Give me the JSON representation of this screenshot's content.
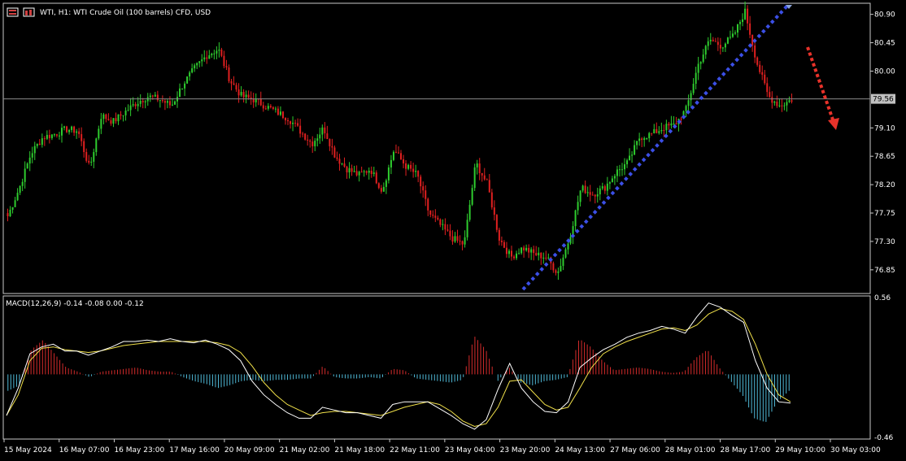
{
  "header": {
    "symbol_title": "WTI, H1:  WTI Crude Oil (100 barrels) CFD, USD"
  },
  "colors": {
    "background": "#000000",
    "bull_candle": "#2ecc2e",
    "bear_candle": "#e02020",
    "trendline": "#3b4fe6",
    "arrow": "#e8322a",
    "macd_line": "#ffffff",
    "signal_line": "#f0e04a",
    "hist_positive": "#d42b2b",
    "hist_negative": "#4fb8d6",
    "grid_border": "#c8c8c8"
  },
  "chart_data": [
    {
      "type": "candlestick",
      "title": "WTI, H1:  WTI Crude Oil (100 barrels) CFD, USD",
      "ylim": [
        76.5,
        81.05
      ],
      "y_ticks": [
        "80.90",
        "80.45",
        "80.00",
        "79.56",
        "79.10",
        "78.65",
        "78.20",
        "77.75",
        "77.30",
        "76.85"
      ],
      "current_price": "79.56",
      "x_ticks": [
        "15 May 2024",
        "16 May 07:00",
        "16 May 23:00",
        "17 May 16:00",
        "20 May 09:00",
        "21 May 02:00",
        "21 May 18:00",
        "22 May 11:00",
        "23 May 04:00",
        "23 May 20:00",
        "24 May 13:00",
        "27 May 06:00",
        "28 May 01:00",
        "28 May 17:00",
        "29 May 10:00",
        "30 May 03:00"
      ],
      "closes": [
        77.7,
        78.15,
        78.7,
        78.95,
        79.0,
        79.08,
        79.05,
        78.45,
        79.3,
        79.2,
        79.35,
        79.5,
        79.6,
        79.55,
        79.45,
        79.8,
        80.05,
        80.25,
        80.35,
        79.85,
        79.6,
        79.55,
        79.45,
        79.35,
        79.25,
        79.05,
        78.85,
        79.1,
        78.65,
        78.45,
        78.35,
        78.45,
        78.1,
        78.75,
        78.5,
        78.35,
        77.75,
        77.55,
        77.35,
        77.25,
        78.55,
        78.2,
        77.35,
        77.05,
        77.2,
        77.1,
        77.05,
        76.8,
        77.35,
        78.15,
        78.05,
        78.15,
        78.4,
        78.55,
        78.95,
        79.0,
        79.1,
        79.15,
        79.4,
        80.1,
        80.5,
        80.4,
        80.55,
        80.95,
        80.15,
        79.6,
        79.45,
        79.55
      ],
      "trendline": {
        "from": {
          "x": "24 May 13:00",
          "y": 76.6
        },
        "to": {
          "x": "29 May 17:00",
          "y": 81.05
        }
      },
      "forecast_arrow": "down"
    },
    {
      "type": "macd",
      "label": "MACD(12,26,9) -0.14 -0.08 0.00 -0.12",
      "params": "12,26,9",
      "values": [
        "-0.14",
        "-0.08",
        "0.00",
        "-0.12"
      ],
      "ylim": [
        -0.46,
        0.56
      ],
      "y_ticks": [
        "0.56",
        "-0.46"
      ],
      "macd": [
        -0.3,
        -0.1,
        0.15,
        0.2,
        0.22,
        0.17,
        0.17,
        0.14,
        0.17,
        0.2,
        0.24,
        0.24,
        0.25,
        0.24,
        0.26,
        0.24,
        0.23,
        0.25,
        0.22,
        0.18,
        0.1,
        -0.05,
        -0.15,
        -0.22,
        -0.28,
        -0.32,
        -0.32,
        -0.24,
        -0.26,
        -0.28,
        -0.28,
        -0.3,
        -0.32,
        -0.22,
        -0.2,
        -0.2,
        -0.2,
        -0.25,
        -0.3,
        -0.36,
        -0.4,
        -0.33,
        -0.11,
        0.08,
        -0.1,
        -0.2,
        -0.27,
        -0.28,
        -0.2,
        0.05,
        0.12,
        0.18,
        0.22,
        0.27,
        0.3,
        0.32,
        0.35,
        0.33,
        0.3,
        0.42,
        0.52,
        0.49,
        0.43,
        0.38,
        0.1,
        -0.1,
        -0.2,
        -0.21
      ],
      "signal": [
        -0.3,
        -0.15,
        0.1,
        0.19,
        0.2,
        0.18,
        0.17,
        0.16,
        0.17,
        0.19,
        0.21,
        0.22,
        0.23,
        0.24,
        0.24,
        0.24,
        0.24,
        0.24,
        0.23,
        0.21,
        0.16,
        0.06,
        -0.06,
        -0.15,
        -0.22,
        -0.26,
        -0.3,
        -0.28,
        -0.27,
        -0.27,
        -0.28,
        -0.29,
        -0.3,
        -0.27,
        -0.24,
        -0.22,
        -0.2,
        -0.22,
        -0.27,
        -0.34,
        -0.38,
        -0.36,
        -0.24,
        -0.05,
        -0.04,
        -0.13,
        -0.22,
        -0.26,
        -0.24,
        -0.1,
        0.05,
        0.15,
        0.2,
        0.24,
        0.27,
        0.3,
        0.33,
        0.34,
        0.32,
        0.36,
        0.44,
        0.48,
        0.46,
        0.4,
        0.22,
        0.0,
        -0.15,
        -0.2
      ],
      "histogram": [
        -0.12,
        -0.08,
        0.18,
        0.25,
        0.15,
        0.05,
        0.02,
        -0.02,
        0.02,
        0.03,
        0.04,
        0.05,
        0.03,
        0.02,
        0.02,
        -0.02,
        -0.05,
        -0.07,
        -0.1,
        -0.08,
        -0.05,
        -0.04,
        -0.05,
        -0.04,
        -0.04,
        -0.03,
        -0.03,
        0.06,
        -0.02,
        -0.03,
        -0.03,
        -0.02,
        -0.03,
        0.04,
        0.03,
        -0.03,
        -0.04,
        -0.05,
        -0.06,
        -0.04,
        0.28,
        0.18,
        -0.05,
        0.05,
        -0.06,
        -0.08,
        -0.05,
        -0.04,
        -0.02,
        0.26,
        0.2,
        0.1,
        0.03,
        0.04,
        0.05,
        0.04,
        0.02,
        0.01,
        0.02,
        0.12,
        0.18,
        0.05,
        -0.05,
        -0.15,
        -0.32,
        -0.35,
        -0.2,
        -0.12
      ]
    }
  ]
}
